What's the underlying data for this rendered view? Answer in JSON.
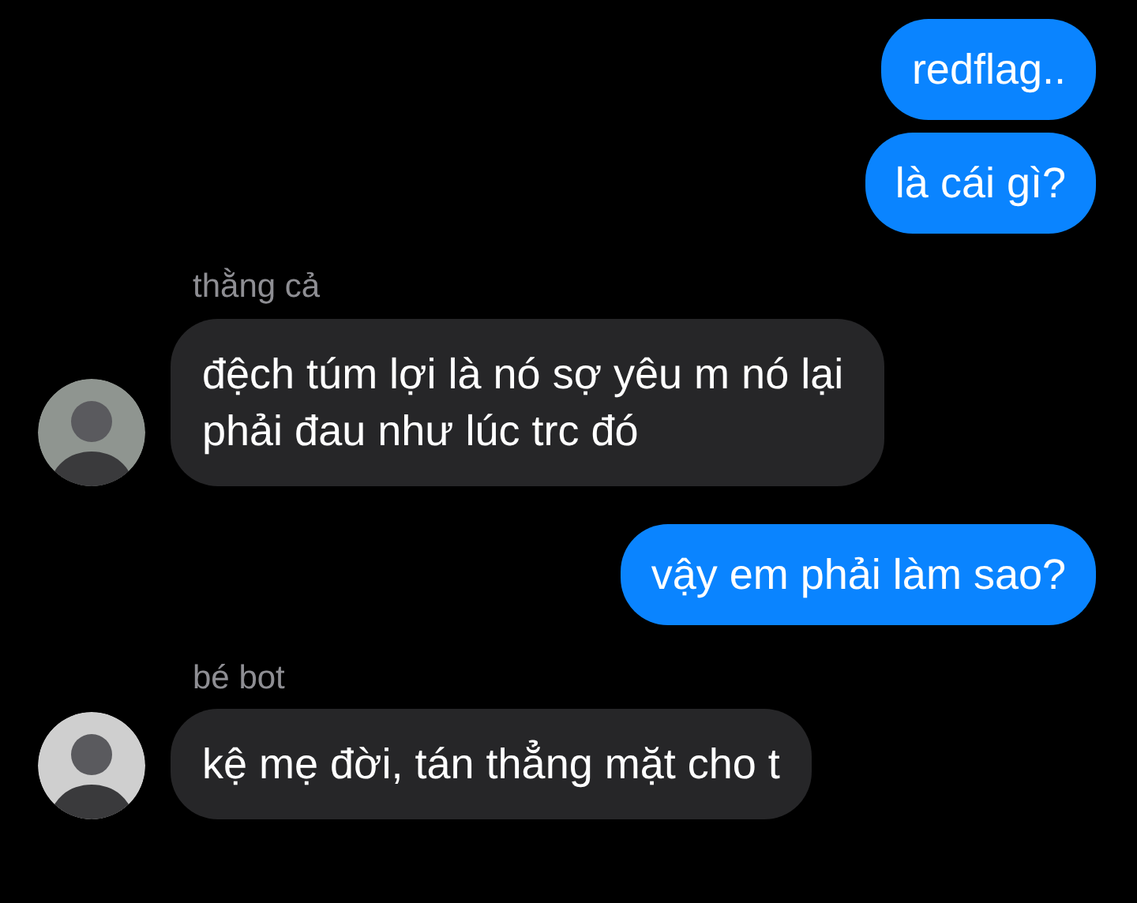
{
  "messages": [
    {
      "kind": "outgoing",
      "text": "redflag.."
    },
    {
      "kind": "outgoing",
      "text": "là cái gì?"
    },
    {
      "kind": "incoming",
      "sender": "thằng cả",
      "text": "đệch túm lợi là nó sợ yêu m nó lại phải đau như lúc trc đó"
    },
    {
      "kind": "outgoing",
      "text": "vậy em phải làm sao?"
    },
    {
      "kind": "incoming",
      "sender": "bé bot",
      "text": "kệ mẹ đời, tán thẳng mặt cho t"
    }
  ]
}
